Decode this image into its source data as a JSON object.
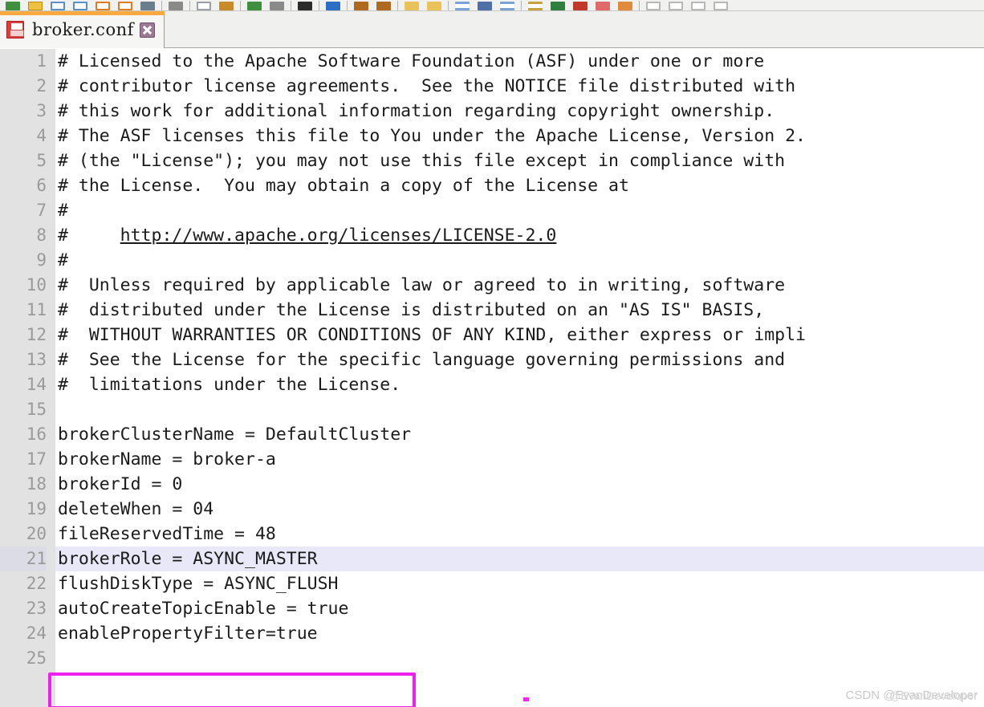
{
  "toolbar": {
    "icons": [
      {
        "name": "save-all-icon",
        "color": "#3f8f3f",
        "shape": "check"
      },
      {
        "name": "open-folder-icon",
        "color": "#f0c040",
        "shape": "folder"
      },
      {
        "name": "new-document-icon",
        "color": "#5b8fc9",
        "shape": "doc"
      },
      {
        "name": "save-as-icon",
        "color": "#5b8fc9",
        "shape": "doc"
      },
      {
        "name": "close-document-icon",
        "color": "#e07b20",
        "shape": "doc-orange"
      },
      {
        "name": "close-all-icon",
        "color": "#e07b20",
        "shape": "doc-orange"
      },
      {
        "name": "print-icon",
        "color": "#6a7d8c",
        "shape": "printer"
      },
      {
        "name": "separator-1",
        "shape": "sep"
      },
      {
        "name": "cut-icon",
        "color": "#8a8a8a",
        "shape": "scissors"
      },
      {
        "name": "separator-2",
        "shape": "sep"
      },
      {
        "name": "copy-icon",
        "color": "#9aa0a6",
        "shape": "doc"
      },
      {
        "name": "paste-icon",
        "color": "#c98b2a",
        "shape": "clipboard"
      },
      {
        "name": "separator-3",
        "shape": "sep"
      },
      {
        "name": "undo-icon",
        "color": "#3f8f3f",
        "shape": "arrow"
      },
      {
        "name": "redo-icon",
        "color": "#8a8a8a",
        "shape": "arrow"
      },
      {
        "name": "separator-4",
        "shape": "sep"
      },
      {
        "name": "find-icon",
        "color": "#2c2c2c",
        "shape": "binoculars"
      },
      {
        "name": "separator-5",
        "shape": "sep"
      },
      {
        "name": "replace-icon",
        "color": "#2d6fc4",
        "shape": "replace"
      },
      {
        "name": "separator-6",
        "shape": "sep"
      },
      {
        "name": "zoom-in-icon",
        "color": "#b06a20",
        "shape": "magnifier"
      },
      {
        "name": "zoom-out-icon",
        "color": "#b06a20",
        "shape": "magnifier"
      },
      {
        "name": "separator-7",
        "shape": "sep"
      },
      {
        "name": "bookmark-icon",
        "color": "#e9c35a",
        "shape": "note"
      },
      {
        "name": "bookmark-next-icon",
        "color": "#e9c35a",
        "shape": "note"
      },
      {
        "name": "separator-8",
        "shape": "sep"
      },
      {
        "name": "word-wrap-icon",
        "color": "#7aa4d8",
        "shape": "wrap"
      },
      {
        "name": "show-all-chars-icon",
        "color": "#4f6fa8",
        "shape": "pilcrow"
      },
      {
        "name": "indent-guide-icon",
        "color": "#7aa4d8",
        "shape": "guide"
      },
      {
        "name": "separator-9",
        "shape": "sep"
      },
      {
        "name": "sync-scroll-icon",
        "color": "#c8a23c",
        "shape": "sync"
      },
      {
        "name": "macro-record-icon",
        "color": "#2f7f3f",
        "shape": "record"
      },
      {
        "name": "macro-stop-icon",
        "color": "#c0392b",
        "shape": "stop"
      },
      {
        "name": "macro-play-icon",
        "color": "#e06a6a",
        "shape": "play"
      },
      {
        "name": "macro-save-icon",
        "color": "#e08a3c",
        "shape": "save"
      },
      {
        "name": "separator-10",
        "shape": "sep"
      },
      {
        "name": "panel-1-icon",
        "color": "#b8b8b8",
        "shape": "panel"
      },
      {
        "name": "panel-2-icon",
        "color": "#b8b8b8",
        "shape": "panel"
      },
      {
        "name": "panel-3-icon",
        "color": "#b8b8b8",
        "shape": "panel"
      },
      {
        "name": "panel-4-icon",
        "color": "#b8b8b8",
        "shape": "panel"
      }
    ]
  },
  "tab": {
    "title": "broker.conf",
    "active_accent_color": "#f9a93e",
    "save_icon_name": "save-icon",
    "close_icon_name": "close-icon"
  },
  "editor": {
    "highlighted_line": 21,
    "selection_highlight_color": "#e8e8f8",
    "gutter_color": "#e2e2e2",
    "lines": [
      {
        "n": "1",
        "text": "# Licensed to the Apache Software Foundation (ASF) under one or more"
      },
      {
        "n": "2",
        "text": "# contributor license agreements.  See the NOTICE file distributed with"
      },
      {
        "n": "3",
        "text": "# this work for additional information regarding copyright ownership."
      },
      {
        "n": "4",
        "text": "# The ASF licenses this file to You under the Apache License, Version 2."
      },
      {
        "n": "5",
        "text": "# (the \"License\"); you may not use this file except in compliance with"
      },
      {
        "n": "6",
        "text": "# the License.  You may obtain a copy of the License at"
      },
      {
        "n": "7",
        "text": "#"
      },
      {
        "n": "8",
        "text": "#     http://www.apache.org/licenses/LICENSE-2.0",
        "link": true,
        "prefix": "#     ",
        "link_text": "http://www.apache.org/licenses/LICENSE-2.0"
      },
      {
        "n": "9",
        "text": "#"
      },
      {
        "n": "10",
        "text": "#  Unless required by applicable law or agreed to in writing, software"
      },
      {
        "n": "11",
        "text": "#  distributed under the License is distributed on an \"AS IS\" BASIS,"
      },
      {
        "n": "12",
        "text": "#  WITHOUT WARRANTIES OR CONDITIONS OF ANY KIND, either express or impli"
      },
      {
        "n": "13",
        "text": "#  See the License for the specific language governing permissions and"
      },
      {
        "n": "14",
        "text": "#  limitations under the License."
      },
      {
        "n": "15",
        "text": ""
      },
      {
        "n": "16",
        "text": "brokerClusterName = DefaultCluster"
      },
      {
        "n": "17",
        "text": "brokerName = broker-a"
      },
      {
        "n": "18",
        "text": "brokerId = 0"
      },
      {
        "n": "19",
        "text": "deleteWhen = 04"
      },
      {
        "n": "20",
        "text": "fileReservedTime = 48"
      },
      {
        "n": "21",
        "text": "brokerRole = ASYNC_MASTER",
        "highlighted": true
      },
      {
        "n": "22",
        "text": "flushDiskType = ASYNC_FLUSH"
      },
      {
        "n": "23",
        "text": "autoCreateTopicEnable = true"
      },
      {
        "n": "24",
        "text": "enablePropertyFilter=true"
      },
      {
        "n": "25",
        "text": ""
      }
    ]
  },
  "annotation": {
    "box_color": "#ee20ee",
    "target_line": "24",
    "target_text": "enablePropertyFilter=true",
    "dot_color": "#f224f2"
  },
  "watermark": {
    "text": "CSDN @EvanDeveloper",
    "overlay_text": "@EvanDeveloper"
  }
}
